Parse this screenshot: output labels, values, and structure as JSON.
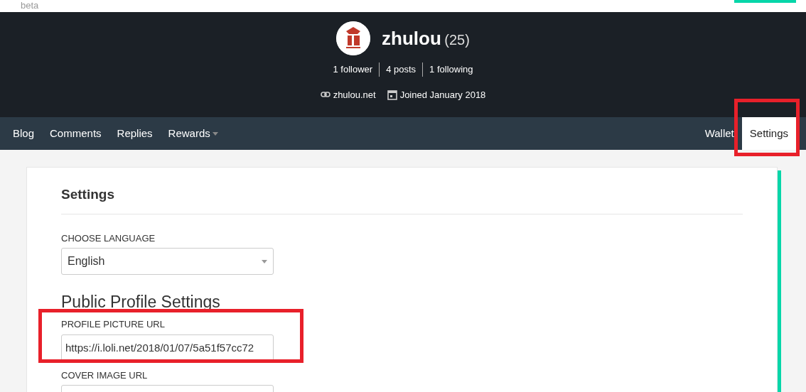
{
  "topbar": {
    "beta": "beta"
  },
  "profile": {
    "name": "zhulou",
    "reputation": "(25)",
    "stats": [
      "1 follower",
      "4 posts",
      "1 following"
    ],
    "website": "zhulou.net",
    "joined": "Joined January 2018"
  },
  "nav": {
    "left": [
      {
        "label": "Blog",
        "selected": false,
        "dropdown": false
      },
      {
        "label": "Comments",
        "selected": false,
        "dropdown": false
      },
      {
        "label": "Replies",
        "selected": false,
        "dropdown": false
      },
      {
        "label": "Rewards",
        "selected": false,
        "dropdown": true
      }
    ],
    "right": [
      {
        "label": "Wallet",
        "selected": false
      },
      {
        "label": "Settings",
        "selected": true
      }
    ]
  },
  "settings": {
    "title": "Settings",
    "language_label": "CHOOSE LANGUAGE",
    "language": "English",
    "section": "Public Profile Settings",
    "fields": [
      {
        "label": "PROFILE PICTURE URL",
        "value": "https://i.loli.net/2018/01/07/5a51f57cc72"
      },
      {
        "label": "COVER IMAGE URL"
      }
    ]
  }
}
